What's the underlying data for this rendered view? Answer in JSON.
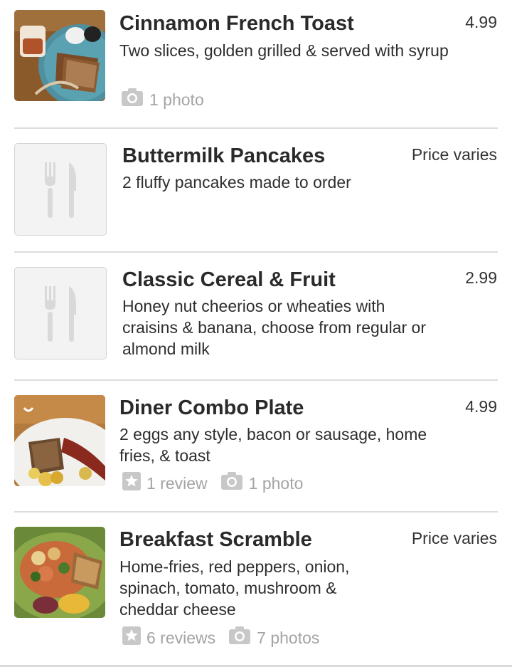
{
  "menu": {
    "items": [
      {
        "title": "Cinnamon French Toast",
        "price": "4.99",
        "description": "Two slices, golden grilled & served with syrup",
        "photo": "1 photo",
        "image": "french-toast-photo"
      },
      {
        "title": "Buttermilk Pancakes",
        "price": "Price varies",
        "description": "2 fluffy pancakes made to order",
        "image": "fork-knife-placeholder-icon"
      },
      {
        "title": "Classic Cereal & Fruit",
        "price": "2.99",
        "description": "Honey nut cheerios or wheaties with craisins & banana, choose from regular or almond milk",
        "image": "fork-knife-placeholder-icon"
      },
      {
        "title": "Diner Combo Plate",
        "price": "4.99",
        "description": "2 eggs any style, bacon or sausage, home fries, & toast",
        "review": "1 review",
        "photo": "1 photo",
        "image": "combo-plate-photo"
      },
      {
        "title": "Breakfast Scramble",
        "price": "Price varies",
        "description": "Home-fries, red peppers, onion, spinach, tomato, mushroom & cheddar cheese",
        "review": "6 reviews",
        "photo": "7 photos",
        "image": "scramble-photo"
      }
    ]
  },
  "colors": {
    "text": "#222222",
    "meta": "#a4a4a4",
    "divider": "#dcdcdc"
  }
}
